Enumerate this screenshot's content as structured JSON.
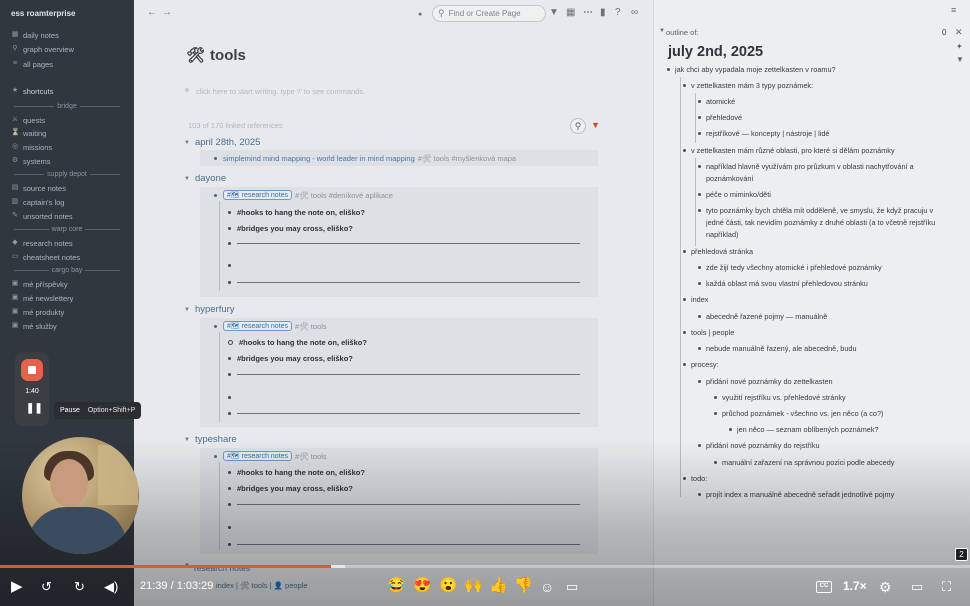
{
  "sidebar": {
    "graph_name": "ess roamterprise",
    "nav": [
      {
        "label": "daily notes",
        "icon": "calendar-icon"
      },
      {
        "label": "graph overview",
        "icon": "graph-icon"
      },
      {
        "label": "all pages",
        "icon": "list-icon"
      }
    ],
    "shortcuts_label": "shortcuts",
    "sep_bridge": "bridge",
    "bridge_items": [
      "quests",
      "waiting",
      "missions",
      "systems"
    ],
    "sep_supply": "supply depot",
    "supply_items": [
      "source notes",
      "captain's log",
      "unsorted notes"
    ],
    "sep_warp": "warp core",
    "warp_items": [
      "research notes",
      "cheatsheet notes"
    ],
    "sep_cargo": "cargo bay",
    "cargo_items": [
      "mé příspěvky",
      "mé newslettery",
      "mé produkty",
      "mé služby"
    ]
  },
  "topbar": {
    "search_placeholder": "Find or Create Page"
  },
  "page": {
    "title_icon": "🛠",
    "title": "tools",
    "placeholder": "click here to start writing. type '/' to see commands.",
    "linked_count": "103 of 170 linked references"
  },
  "refs": [
    {
      "title": "april 28th, 2025",
      "row_link": "simplemind mind mapping - world leader in mind mapping",
      "row_tags": "#🛠 tools #myšlenková mapa"
    },
    {
      "title": "dayone",
      "pill": "#🗺 research notes",
      "row_tags": "#🛠 tools #deníkové aplikace",
      "children": [
        "#hooks to hang the note on, eliško?",
        "#bridges you may cross, eliško?"
      ]
    },
    {
      "title": "hyperfury",
      "pill": "#🗺 research notes",
      "row_tags": "#🛠 tools",
      "children": [
        "#hooks to hang the note on, eliško?",
        "#bridges you may cross, eliško?"
      ]
    },
    {
      "title": "typeshare",
      "pill": "#🗺 research notes",
      "row_tags": "#🛠 tools",
      "children": [
        "#hooks to hang the note on, eliško?",
        "#bridges you may cross, eliško?"
      ]
    }
  ],
  "bottom_ref": {
    "title": "research notes",
    "path": "index | 🛠 tools | 👤 people"
  },
  "outline": {
    "label": "outline of:",
    "count": "0",
    "title": "july 2nd, 2025",
    "items": [
      "jak chci aby vypadala moje zettelkasten v roamu?",
      "v zettelkasten mám 3 typy poznámek:",
      "atomické",
      "přehledové",
      "rejstříkové — koncepty | nástroje | lidé",
      "v zettelkasten mám různé oblasti, pro které si dělám poznámky",
      "například hlavně využívám pro průzkum v oblasti nachytřování a poznámkování",
      "péče o miminko/děti",
      "tyto poznámky bych chtěla mít odděleně, ve smyslu, že když pracuju v jedné části, tak nevidím poznámky z druhé oblasti (a to včetně rejstříku například)",
      "přehledová stránka",
      "zde žijí tedy všechny atomické i přehledové poznámky",
      "každá oblast má svou vlastní přehledovou stránku",
      "index",
      "abecedně řazené pojmy — manuálně",
      "tools | people",
      "nebude manuálně řazený, ale abecedně, budu",
      "procesy:",
      "přidání nové poznámky do zettelkasten",
      "využití rejstříku vs. přehledové stránky",
      "průchod poznámek - všechno vs. jen něco (a co?)",
      "jen něco — seznam oblíbených poznámek?",
      "přidání nové poznámky do rejstříku",
      "manuální zařazení na správnou pozici podle abecedy",
      "todo:",
      "projít index a manuálně abecedně seřadit jednotlivé pojmy"
    ]
  },
  "recorder": {
    "elapsed": "1:40",
    "tooltip_label": "Pause",
    "tooltip_shortcut": "Option+Shift+P"
  },
  "player": {
    "time": "21:39 / 1:03:29",
    "progress": 0.341,
    "buffered": 0.356,
    "speed": "1.7×",
    "cc_label": "CC",
    "badge": "2",
    "reactions": [
      "😂",
      "😍",
      "😮",
      "🙌",
      "👍",
      "👎"
    ],
    "accent": "#e2553c"
  }
}
